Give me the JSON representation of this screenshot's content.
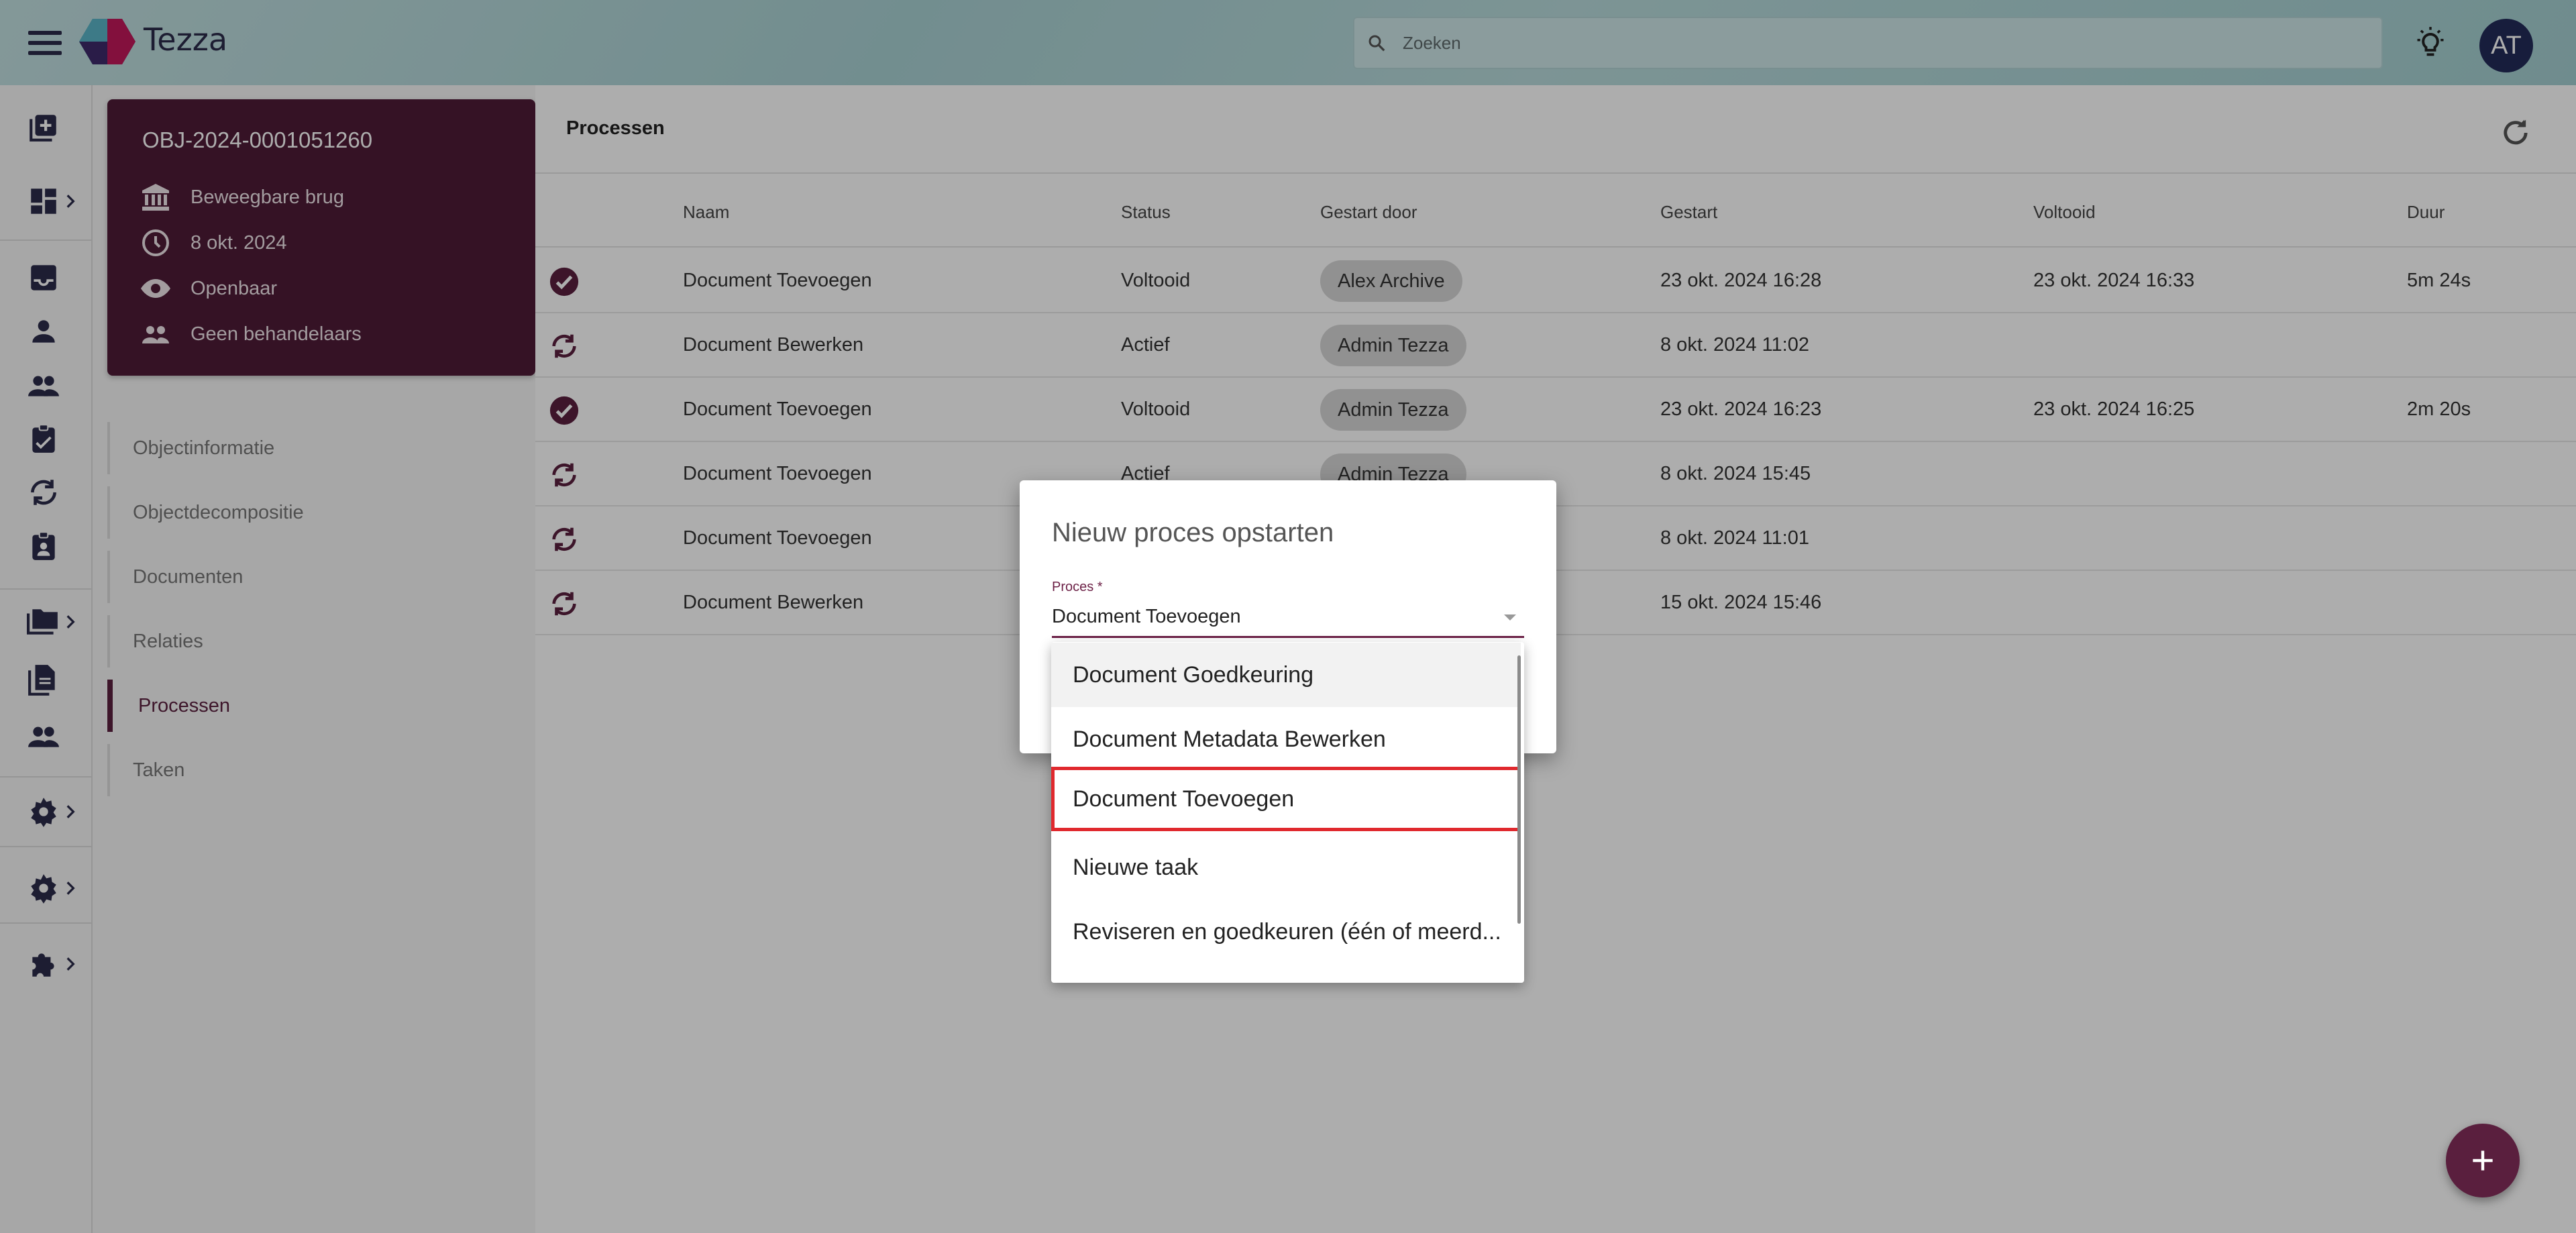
{
  "app": {
    "name": "Tezza"
  },
  "search": {
    "placeholder": "Zoeken"
  },
  "user": {
    "initials": "AT"
  },
  "object_card": {
    "id": "OBJ-2024-0001051260",
    "type": "Beweegbare brug",
    "date": "8 okt. 2024",
    "visibility": "Openbaar",
    "handlers": "Geen behandelaars"
  },
  "section_nav": [
    {
      "label": "Objectinformatie"
    },
    {
      "label": "Objectdecompositie"
    },
    {
      "label": "Documenten"
    },
    {
      "label": "Relaties"
    },
    {
      "label": "Processen"
    },
    {
      "label": "Taken"
    }
  ],
  "panel": {
    "title": "Processen"
  },
  "table": {
    "columns": [
      "Naam",
      "Status",
      "Gestart door",
      "Gestart",
      "Voltooid",
      "Duur"
    ],
    "rows": [
      {
        "icon": "check-circle-icon",
        "naam": "Document Toevoegen",
        "status": "Voltooid",
        "gestart_door": "Alex Archive",
        "gestart": "23 okt. 2024 16:28",
        "voltooid": "23 okt. 2024 16:33",
        "duur": "5m 24s"
      },
      {
        "icon": "sync-icon",
        "naam": "Document Bewerken",
        "status": "Actief",
        "gestart_door": "Admin Tezza",
        "gestart": "8 okt. 2024 11:02",
        "voltooid": "",
        "duur": ""
      },
      {
        "icon": "check-circle-icon",
        "naam": "Document Toevoegen",
        "status": "Voltooid",
        "gestart_door": "Admin Tezza",
        "gestart": "23 okt. 2024 16:23",
        "voltooid": "23 okt. 2024 16:25",
        "duur": "2m 20s"
      },
      {
        "icon": "sync-icon",
        "naam": "Document Toevoegen",
        "status": "Actief",
        "gestart_door": "Admin Tezza",
        "gestart": "8 okt. 2024 15:45",
        "voltooid": "",
        "duur": ""
      },
      {
        "icon": "sync-icon",
        "naam": "Document Toevoegen",
        "status": "",
        "gestart_door": "",
        "gestart": "8 okt. 2024 11:01",
        "voltooid": "",
        "duur": ""
      },
      {
        "icon": "sync-icon",
        "naam": "Document Bewerken",
        "status": "",
        "gestart_door": "",
        "gestart": "15 okt. 2024 15:46",
        "voltooid": "",
        "duur": ""
      }
    ]
  },
  "dialog": {
    "title": "Nieuw proces opstarten",
    "field_label": "Proces *",
    "field_value": "Document Toevoegen",
    "options": [
      {
        "label": "Document Goedkeuring"
      },
      {
        "label": "Document Metadata Bewerken"
      },
      {
        "label": "Document Toevoegen"
      },
      {
        "label": "Nieuwe taak"
      },
      {
        "label": "Reviseren en goedkeuren (één of meerd..."
      }
    ]
  },
  "colors": {
    "brand": "#5a1f3e",
    "card": "#4e1b37",
    "topbar": "#aed4d6",
    "highlight": "#e0292e"
  }
}
